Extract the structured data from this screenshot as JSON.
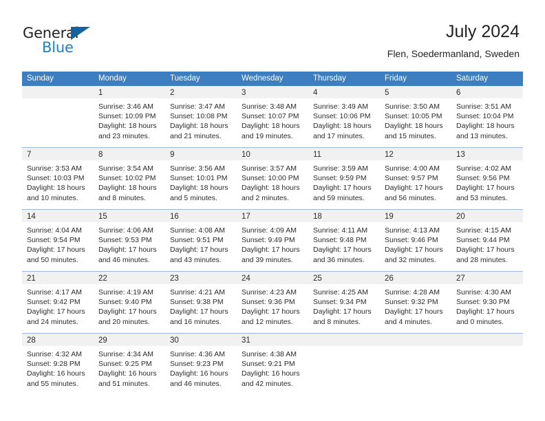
{
  "brand": {
    "name_part1": "General",
    "name_part2": "Blue",
    "triangle_color": "#14629e",
    "blue_color": "#1f7fc4"
  },
  "header": {
    "title": "July 2024",
    "subtitle": "Flen, Soedermanland, Sweden"
  },
  "theme": {
    "header_row_bg": "#3c7ebf",
    "header_row_text": "#ffffff",
    "daynum_band_bg": "#f1f1f1",
    "row_divider": "#9bb9d6",
    "text": "#2a2a2a"
  },
  "weekdays": [
    "Sunday",
    "Monday",
    "Tuesday",
    "Wednesday",
    "Thursday",
    "Friday",
    "Saturday"
  ],
  "weeks": [
    [
      {
        "day": "",
        "lines": []
      },
      {
        "day": "1",
        "lines": [
          "Sunrise: 3:46 AM",
          "Sunset: 10:09 PM",
          "Daylight: 18 hours",
          "and 23 minutes."
        ]
      },
      {
        "day": "2",
        "lines": [
          "Sunrise: 3:47 AM",
          "Sunset: 10:08 PM",
          "Daylight: 18 hours",
          "and 21 minutes."
        ]
      },
      {
        "day": "3",
        "lines": [
          "Sunrise: 3:48 AM",
          "Sunset: 10:07 PM",
          "Daylight: 18 hours",
          "and 19 minutes."
        ]
      },
      {
        "day": "4",
        "lines": [
          "Sunrise: 3:49 AM",
          "Sunset: 10:06 PM",
          "Daylight: 18 hours",
          "and 17 minutes."
        ]
      },
      {
        "day": "5",
        "lines": [
          "Sunrise: 3:50 AM",
          "Sunset: 10:05 PM",
          "Daylight: 18 hours",
          "and 15 minutes."
        ]
      },
      {
        "day": "6",
        "lines": [
          "Sunrise: 3:51 AM",
          "Sunset: 10:04 PM",
          "Daylight: 18 hours",
          "and 13 minutes."
        ]
      }
    ],
    [
      {
        "day": "7",
        "lines": [
          "Sunrise: 3:53 AM",
          "Sunset: 10:03 PM",
          "Daylight: 18 hours",
          "and 10 minutes."
        ]
      },
      {
        "day": "8",
        "lines": [
          "Sunrise: 3:54 AM",
          "Sunset: 10:02 PM",
          "Daylight: 18 hours",
          "and 8 minutes."
        ]
      },
      {
        "day": "9",
        "lines": [
          "Sunrise: 3:56 AM",
          "Sunset: 10:01 PM",
          "Daylight: 18 hours",
          "and 5 minutes."
        ]
      },
      {
        "day": "10",
        "lines": [
          "Sunrise: 3:57 AM",
          "Sunset: 10:00 PM",
          "Daylight: 18 hours",
          "and 2 minutes."
        ]
      },
      {
        "day": "11",
        "lines": [
          "Sunrise: 3:59 AM",
          "Sunset: 9:59 PM",
          "Daylight: 17 hours",
          "and 59 minutes."
        ]
      },
      {
        "day": "12",
        "lines": [
          "Sunrise: 4:00 AM",
          "Sunset: 9:57 PM",
          "Daylight: 17 hours",
          "and 56 minutes."
        ]
      },
      {
        "day": "13",
        "lines": [
          "Sunrise: 4:02 AM",
          "Sunset: 9:56 PM",
          "Daylight: 17 hours",
          "and 53 minutes."
        ]
      }
    ],
    [
      {
        "day": "14",
        "lines": [
          "Sunrise: 4:04 AM",
          "Sunset: 9:54 PM",
          "Daylight: 17 hours",
          "and 50 minutes."
        ]
      },
      {
        "day": "15",
        "lines": [
          "Sunrise: 4:06 AM",
          "Sunset: 9:53 PM",
          "Daylight: 17 hours",
          "and 46 minutes."
        ]
      },
      {
        "day": "16",
        "lines": [
          "Sunrise: 4:08 AM",
          "Sunset: 9:51 PM",
          "Daylight: 17 hours",
          "and 43 minutes."
        ]
      },
      {
        "day": "17",
        "lines": [
          "Sunrise: 4:09 AM",
          "Sunset: 9:49 PM",
          "Daylight: 17 hours",
          "and 39 minutes."
        ]
      },
      {
        "day": "18",
        "lines": [
          "Sunrise: 4:11 AM",
          "Sunset: 9:48 PM",
          "Daylight: 17 hours",
          "and 36 minutes."
        ]
      },
      {
        "day": "19",
        "lines": [
          "Sunrise: 4:13 AM",
          "Sunset: 9:46 PM",
          "Daylight: 17 hours",
          "and 32 minutes."
        ]
      },
      {
        "day": "20",
        "lines": [
          "Sunrise: 4:15 AM",
          "Sunset: 9:44 PM",
          "Daylight: 17 hours",
          "and 28 minutes."
        ]
      }
    ],
    [
      {
        "day": "21",
        "lines": [
          "Sunrise: 4:17 AM",
          "Sunset: 9:42 PM",
          "Daylight: 17 hours",
          "and 24 minutes."
        ]
      },
      {
        "day": "22",
        "lines": [
          "Sunrise: 4:19 AM",
          "Sunset: 9:40 PM",
          "Daylight: 17 hours",
          "and 20 minutes."
        ]
      },
      {
        "day": "23",
        "lines": [
          "Sunrise: 4:21 AM",
          "Sunset: 9:38 PM",
          "Daylight: 17 hours",
          "and 16 minutes."
        ]
      },
      {
        "day": "24",
        "lines": [
          "Sunrise: 4:23 AM",
          "Sunset: 9:36 PM",
          "Daylight: 17 hours",
          "and 12 minutes."
        ]
      },
      {
        "day": "25",
        "lines": [
          "Sunrise: 4:25 AM",
          "Sunset: 9:34 PM",
          "Daylight: 17 hours",
          "and 8 minutes."
        ]
      },
      {
        "day": "26",
        "lines": [
          "Sunrise: 4:28 AM",
          "Sunset: 9:32 PM",
          "Daylight: 17 hours",
          "and 4 minutes."
        ]
      },
      {
        "day": "27",
        "lines": [
          "Sunrise: 4:30 AM",
          "Sunset: 9:30 PM",
          "Daylight: 17 hours",
          "and 0 minutes."
        ]
      }
    ],
    [
      {
        "day": "28",
        "lines": [
          "Sunrise: 4:32 AM",
          "Sunset: 9:28 PM",
          "Daylight: 16 hours",
          "and 55 minutes."
        ]
      },
      {
        "day": "29",
        "lines": [
          "Sunrise: 4:34 AM",
          "Sunset: 9:25 PM",
          "Daylight: 16 hours",
          "and 51 minutes."
        ]
      },
      {
        "day": "30",
        "lines": [
          "Sunrise: 4:36 AM",
          "Sunset: 9:23 PM",
          "Daylight: 16 hours",
          "and 46 minutes."
        ]
      },
      {
        "day": "31",
        "lines": [
          "Sunrise: 4:38 AM",
          "Sunset: 9:21 PM",
          "Daylight: 16 hours",
          "and 42 minutes."
        ]
      },
      {
        "day": "",
        "lines": []
      },
      {
        "day": "",
        "lines": []
      },
      {
        "day": "",
        "lines": []
      }
    ]
  ]
}
